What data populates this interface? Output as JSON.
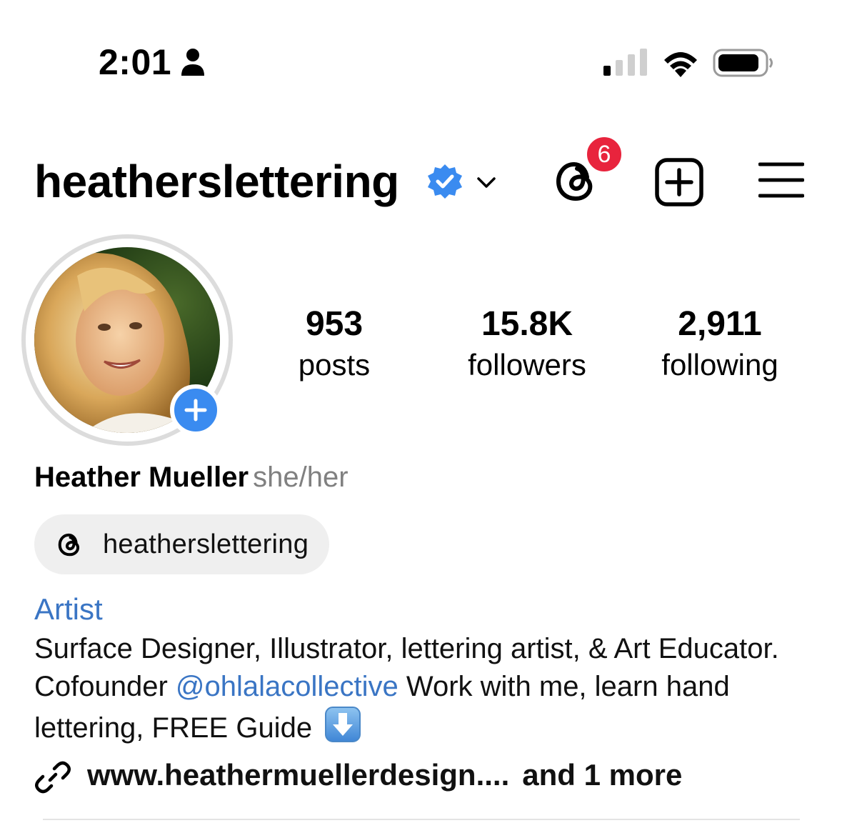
{
  "status_bar": {
    "time": "2:01",
    "person_icon": "person-icon",
    "signal_icon": "cellular-signal-icon",
    "wifi_icon": "wifi-icon",
    "battery_icon": "battery-icon"
  },
  "header": {
    "username": "heatherslettering",
    "verified_icon": "verified-badge-icon",
    "dropdown_icon": "chevron-down-icon",
    "threads_badge_count": "6",
    "threads_icon": "threads-icon",
    "new_post_icon": "plus-square-icon",
    "menu_icon": "hamburger-menu-icon"
  },
  "profile": {
    "avatar_icon": "profile-photo",
    "add_story_icon": "plus-icon",
    "stats": [
      {
        "value": "953",
        "label": "posts"
      },
      {
        "value": "15.8K",
        "label": "followers"
      },
      {
        "value": "2,911",
        "label": "following"
      }
    ],
    "full_name": "Heather Mueller",
    "pronouns": "she/her",
    "threads_chip": "heatherslettering",
    "category": "Artist",
    "bio": {
      "part1": "Surface Designer, Illustrator, lettering artist, & Art Educator. Cofounder ",
      "mention": "@ohlalacollective",
      "part2": " Work with me, learn hand lettering, FREE Guide ",
      "emoji_icon": "down-arrow-emoji-icon"
    },
    "link": {
      "url": "www.heathermuellerdesign....",
      "more": "and 1 more",
      "icon": "link-icon"
    }
  },
  "colors": {
    "accent_blue": "#3a75c4",
    "badge_red": "#e8243d",
    "story_button": "#3a8bf0",
    "chip_bg": "#efefef"
  }
}
